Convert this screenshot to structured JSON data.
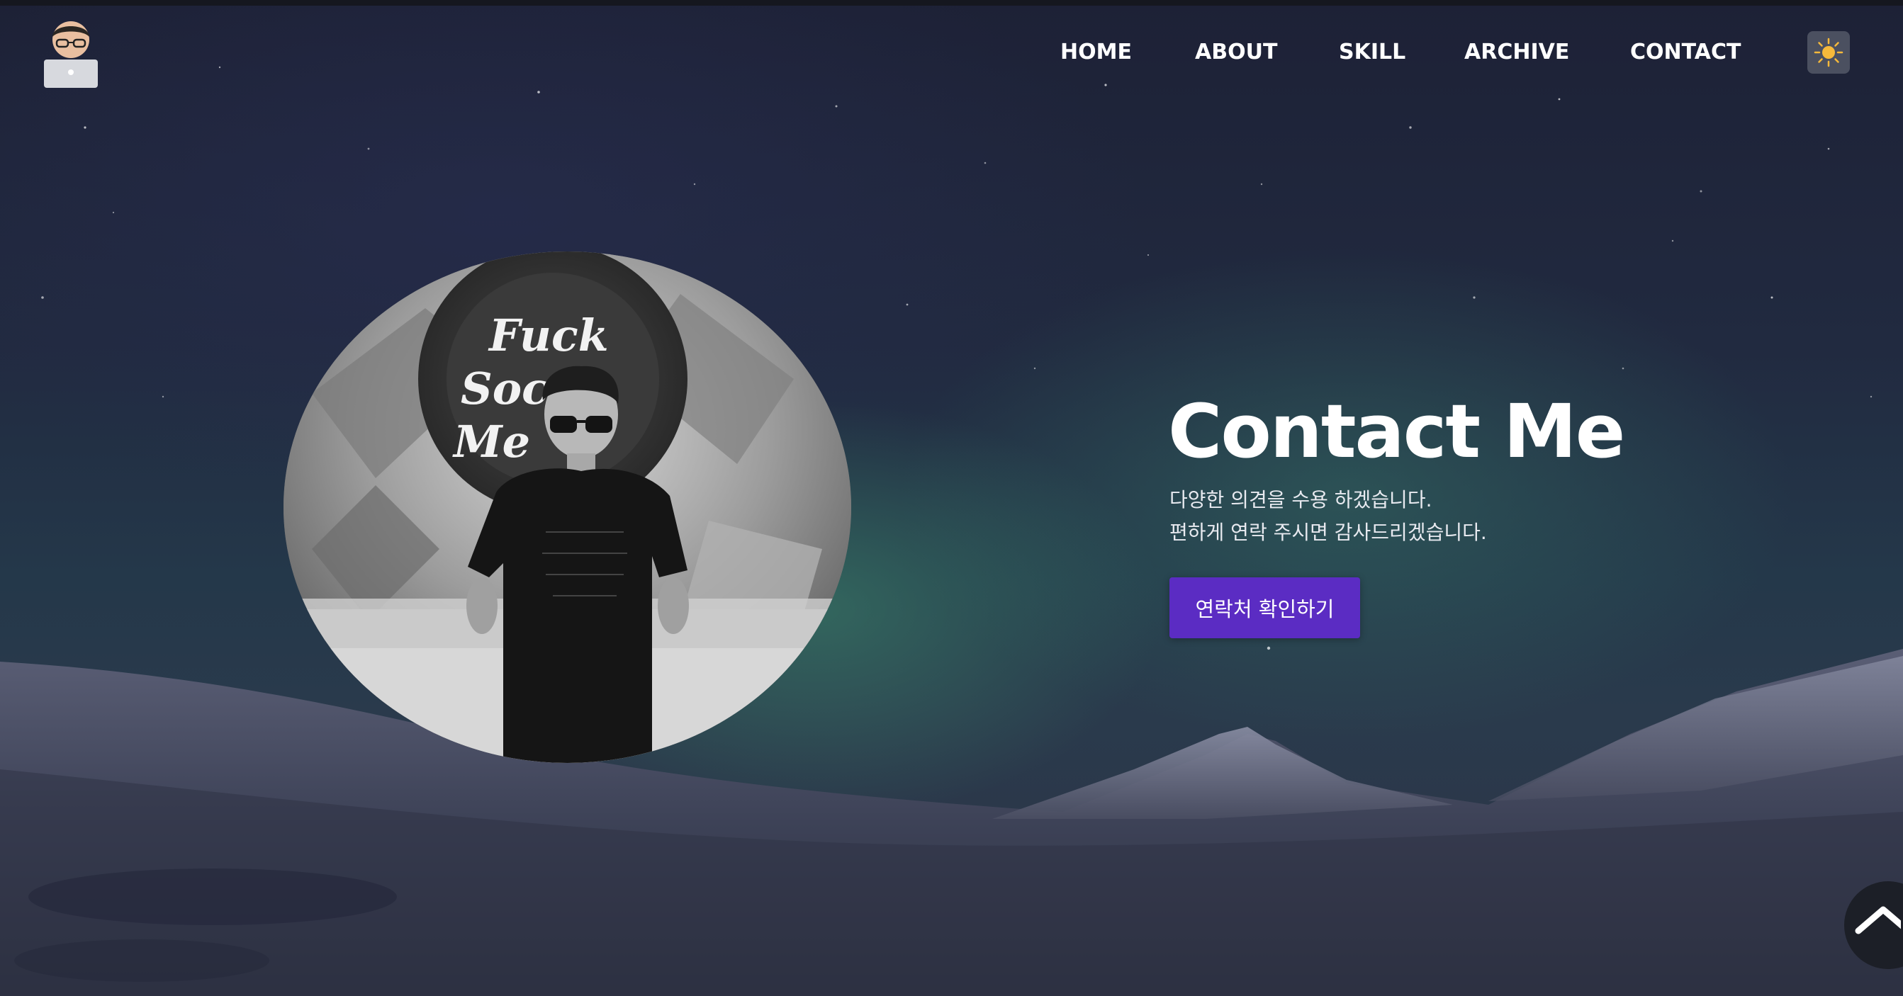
{
  "nav": {
    "items": [
      {
        "label": "HOME"
      },
      {
        "label": "ABOUT"
      },
      {
        "label": "SKILL"
      },
      {
        "label": "ARCHIVE"
      },
      {
        "label": "CONTACT"
      }
    ]
  },
  "theme_toggle": {
    "icon": "sun-icon"
  },
  "hero": {
    "title": "Contact Me",
    "description_line_1": "다양한 의견을 수용 하겠습니다.",
    "description_line_2": "편하게 연락 주시면 감사드리겠습니다.",
    "button_label": "연락처 확인하기"
  },
  "photo_tapestry_text": [
    "Fuck",
    "Soc",
    "Me"
  ],
  "scroll_top": {
    "icon": "chevron-up-icon"
  },
  "colors": {
    "accent_button": "#5b2cc3",
    "nav_text": "#ffffff",
    "background_top": "#1d2136",
    "aurora": "#3e8c6e"
  }
}
